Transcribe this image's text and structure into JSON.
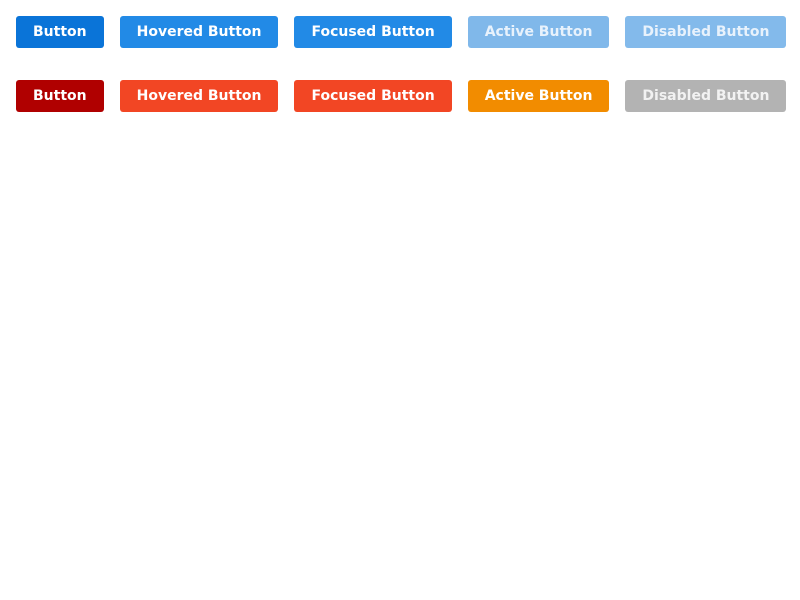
{
  "primary_row": [
    {
      "label": "Button",
      "state": "normal",
      "background": "#0a74d8",
      "text_color": "#ffffff"
    },
    {
      "label": "Hovered Button",
      "state": "hover",
      "background": "#228ae6",
      "text_color": "#ffffff"
    },
    {
      "label": "Focused Button",
      "state": "focus",
      "background": "#228ae6",
      "text_color": "#ffffff"
    },
    {
      "label": "Active Button",
      "state": "active",
      "background": "#80b8ea",
      "text_color": "#e8f2fc"
    },
    {
      "label": "Disabled Button",
      "state": "disabled",
      "background": "#83baeb",
      "text_color": "#e8f2fc"
    }
  ],
  "danger_row": [
    {
      "label": "Button",
      "state": "normal",
      "background": "#b00000",
      "text_color": "#ffffff"
    },
    {
      "label": "Hovered Button",
      "state": "hover",
      "background": "#f24624",
      "text_color": "#ffffff"
    },
    {
      "label": "Focused Button",
      "state": "focus",
      "background": "#f24624",
      "text_color": "#ffffff"
    },
    {
      "label": "Active Button",
      "state": "active",
      "background": "#f28c00",
      "text_color": "#ffffff"
    },
    {
      "label": "Disabled Button",
      "state": "disabled",
      "background": "#b3b3b3",
      "text_color": "#f2f2f2"
    }
  ]
}
